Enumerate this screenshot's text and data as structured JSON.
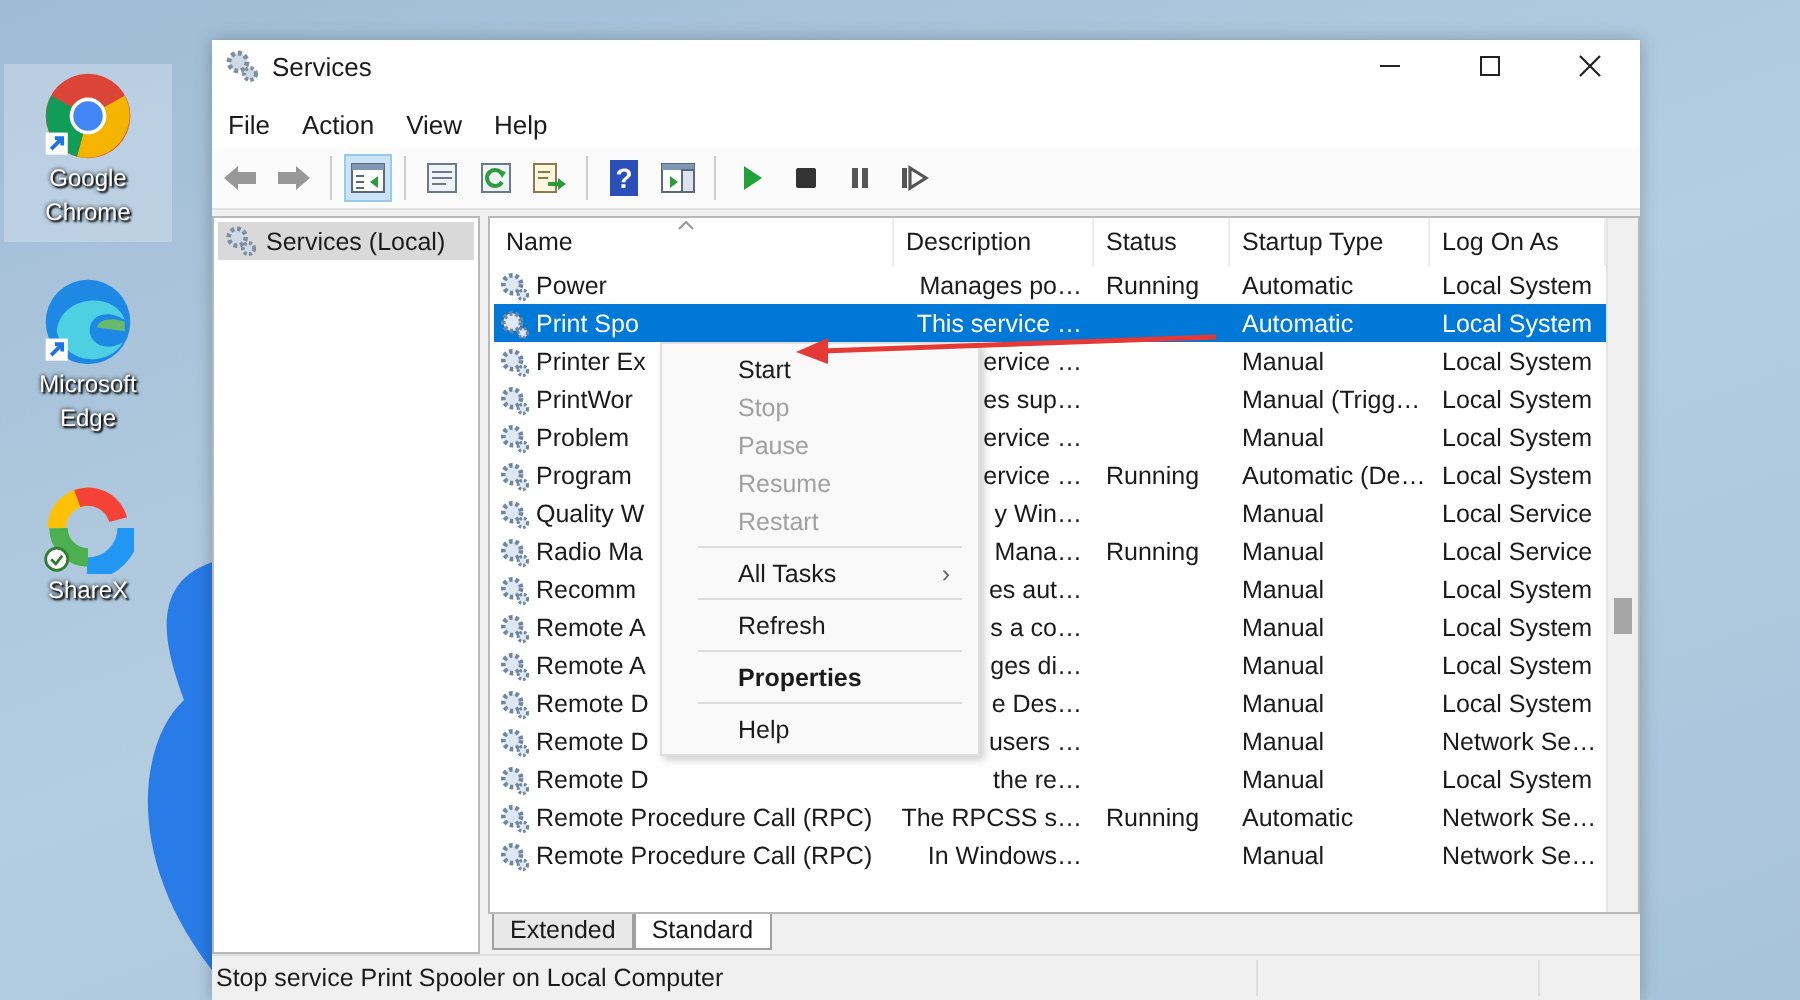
{
  "desktop_icons": [
    {
      "label": "Google Chrome",
      "kind": "chrome",
      "selected": true
    },
    {
      "label": "Microsoft Edge",
      "kind": "edge",
      "selected": false
    },
    {
      "label": "ShareX",
      "kind": "sharex",
      "selected": false
    }
  ],
  "window": {
    "title": "Services"
  },
  "menu_bar": [
    "File",
    "Action",
    "View",
    "Help"
  ],
  "toolbar": [
    {
      "kind": "back",
      "disabled": true,
      "selected": false
    },
    {
      "kind": "forward",
      "disabled": true,
      "selected": false
    },
    {
      "kind": "separator"
    },
    {
      "kind": "tree",
      "disabled": false,
      "selected": true
    },
    {
      "kind": "separator"
    },
    {
      "kind": "properties",
      "disabled": false,
      "selected": false
    },
    {
      "kind": "refresh",
      "disabled": false,
      "selected": false
    },
    {
      "kind": "export",
      "disabled": false,
      "selected": false
    },
    {
      "kind": "separator"
    },
    {
      "kind": "help",
      "label": "?",
      "disabled": false,
      "selected": false
    },
    {
      "kind": "panel",
      "disabled": false,
      "selected": false
    },
    {
      "kind": "separator"
    },
    {
      "kind": "play",
      "disabled": false,
      "selected": false
    },
    {
      "kind": "stop",
      "disabled": false,
      "selected": false
    },
    {
      "kind": "pause",
      "disabled": false,
      "selected": false
    },
    {
      "kind": "resume",
      "disabled": false,
      "selected": false
    }
  ],
  "tree": {
    "items": [
      {
        "label": "Services (Local)",
        "selected": true
      }
    ]
  },
  "table": {
    "columns": [
      "Name",
      "Description",
      "Status",
      "Startup Type",
      "Log On As"
    ],
    "rows": [
      {
        "selected": false,
        "cells": [
          "Power",
          "Manages po…",
          "Running",
          "Automatic",
          "Local System"
        ]
      },
      {
        "selected": true,
        "cells": [
          "Print Spo",
          "This service …",
          "",
          "Automatic",
          "Local System"
        ]
      },
      {
        "selected": false,
        "cells": [
          "Printer Ex",
          "ervice …",
          "",
          "Manual",
          "Local System"
        ]
      },
      {
        "selected": false,
        "cells": [
          "PrintWor",
          "es sup…",
          "",
          "Manual (Trigg…",
          "Local System"
        ]
      },
      {
        "selected": false,
        "cells": [
          "Problem",
          "ervice …",
          "",
          "Manual",
          "Local System"
        ]
      },
      {
        "selected": false,
        "cells": [
          "Program",
          "ervice …",
          "Running",
          "Automatic (De…",
          "Local System"
        ]
      },
      {
        "selected": false,
        "cells": [
          "Quality W",
          "y Win…",
          "",
          "Manual",
          "Local Service"
        ]
      },
      {
        "selected": false,
        "cells": [
          "Radio Ma",
          "Mana…",
          "Running",
          "Manual",
          "Local Service"
        ]
      },
      {
        "selected": false,
        "cells": [
          "Recomm",
          "es aut…",
          "",
          "Manual",
          "Local System"
        ]
      },
      {
        "selected": false,
        "cells": [
          "Remote A",
          "s a co…",
          "",
          "Manual",
          "Local System"
        ]
      },
      {
        "selected": false,
        "cells": [
          "Remote A",
          "ges di…",
          "",
          "Manual",
          "Local System"
        ]
      },
      {
        "selected": false,
        "cells": [
          "Remote D",
          "e Des…",
          "",
          "Manual",
          "Local System"
        ]
      },
      {
        "selected": false,
        "cells": [
          "Remote D",
          "users …",
          "",
          "Manual",
          "Network Se…"
        ]
      },
      {
        "selected": false,
        "cells": [
          "Remote D",
          "the re…",
          "",
          "Manual",
          "Local System"
        ]
      },
      {
        "selected": false,
        "cells": [
          "Remote Procedure Call (RPC)",
          "The RPCSS s…",
          "Running",
          "Automatic",
          "Network Se…"
        ]
      },
      {
        "selected": false,
        "cells": [
          "Remote Procedure Call (RPC)",
          "In Windows…",
          "",
          "Manual",
          "Network Se…"
        ]
      }
    ]
  },
  "context_menu": [
    {
      "kind": "item",
      "label": "Start",
      "disabled": false,
      "bold": false
    },
    {
      "kind": "item",
      "label": "Stop",
      "disabled": true,
      "bold": false
    },
    {
      "kind": "item",
      "label": "Pause",
      "disabled": true,
      "bold": false
    },
    {
      "kind": "item",
      "label": "Resume",
      "disabled": true,
      "bold": false
    },
    {
      "kind": "item",
      "label": "Restart",
      "disabled": true,
      "bold": false
    },
    {
      "kind": "separator"
    },
    {
      "kind": "item",
      "label": "All Tasks",
      "submenu": "›",
      "disabled": false,
      "bold": false
    },
    {
      "kind": "separator"
    },
    {
      "kind": "item",
      "label": "Refresh",
      "disabled": false,
      "bold": false
    },
    {
      "kind": "separator"
    },
    {
      "kind": "item",
      "label": "Properties",
      "disabled": false,
      "bold": true
    },
    {
      "kind": "separator"
    },
    {
      "kind": "item",
      "label": "Help",
      "disabled": false,
      "bold": false
    }
  ],
  "view_tabs": [
    {
      "label": "Extended",
      "selected": false
    },
    {
      "label": "Standard",
      "selected": true
    }
  ],
  "status_bar": "Stop service Print Spooler on Local Computer"
}
